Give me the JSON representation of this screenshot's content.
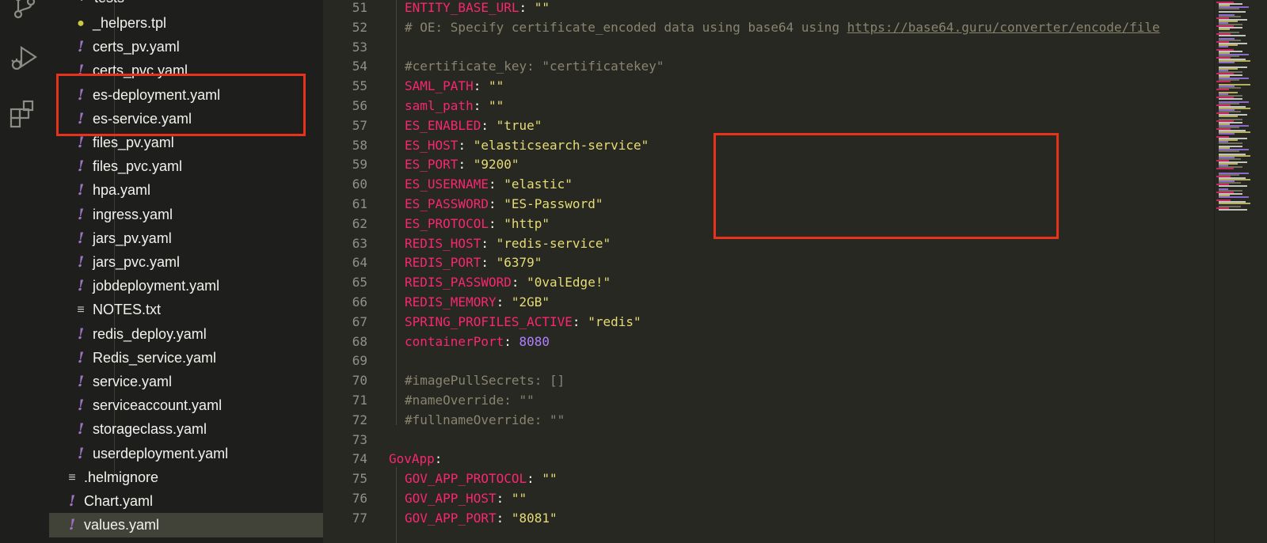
{
  "activity_bar": {
    "icons": [
      "source-control-icon",
      "run-debug-icon",
      "extensions-icon"
    ]
  },
  "sidebar": {
    "partial_top": "tests",
    "items": [
      {
        "label": "_helpers.tpl",
        "icon": "lightbulb-icon"
      },
      {
        "label": "certs_pv.yaml",
        "icon": "yaml-icon"
      },
      {
        "label": "certs_pvc.yaml",
        "icon": "yaml-icon"
      },
      {
        "label": "es-deployment.yaml",
        "icon": "yaml-icon"
      },
      {
        "label": "es-service.yaml",
        "icon": "yaml-icon"
      },
      {
        "label": "files_pv.yaml",
        "icon": "yaml-icon"
      },
      {
        "label": "files_pvc.yaml",
        "icon": "yaml-icon"
      },
      {
        "label": "hpa.yaml",
        "icon": "yaml-icon"
      },
      {
        "label": "ingress.yaml",
        "icon": "yaml-icon"
      },
      {
        "label": "jars_pv.yaml",
        "icon": "yaml-icon"
      },
      {
        "label": "jars_pvc.yaml",
        "icon": "yaml-icon"
      },
      {
        "label": "jobdeployment.yaml",
        "icon": "yaml-icon"
      },
      {
        "label": "NOTES.txt",
        "icon": "text-file-icon"
      },
      {
        "label": "redis_deploy.yaml",
        "icon": "yaml-icon"
      },
      {
        "label": "Redis_service.yaml",
        "icon": "yaml-icon"
      },
      {
        "label": "service.yaml",
        "icon": "yaml-icon"
      },
      {
        "label": "serviceaccount.yaml",
        "icon": "yaml-icon"
      },
      {
        "label": "storageclass.yaml",
        "icon": "yaml-icon"
      },
      {
        "label": "userdeployment.yaml",
        "icon": "yaml-icon"
      },
      {
        "label": ".helmignore",
        "icon": "text-file-icon"
      },
      {
        "label": "Chart.yaml",
        "icon": "yaml-icon"
      },
      {
        "label": "values.yaml",
        "icon": "yaml-icon",
        "active": true
      }
    ]
  },
  "editor": {
    "lines": [
      {
        "n": "51",
        "parts": [
          [
            "k",
            "ENTITY_BASE_URL"
          ],
          [
            "p",
            ": "
          ],
          [
            "s",
            "\"\""
          ]
        ]
      },
      {
        "n": "52",
        "parts": [
          [
            "c",
            "# OE: Specify certificate_encoded data using base64 using "
          ],
          [
            "cu",
            "https://base64.guru/converter/encode/file"
          ]
        ]
      },
      {
        "n": "53",
        "parts": []
      },
      {
        "n": "54",
        "parts": [
          [
            "c",
            "#certificate_key: \"certificatekey\""
          ]
        ]
      },
      {
        "n": "55",
        "parts": [
          [
            "k",
            "SAML_PATH"
          ],
          [
            "p",
            ": "
          ],
          [
            "s",
            "\"\""
          ]
        ]
      },
      {
        "n": "56",
        "parts": [
          [
            "k",
            "saml_path"
          ],
          [
            "p",
            ": "
          ],
          [
            "s",
            "\"\""
          ]
        ]
      },
      {
        "n": "57",
        "parts": [
          [
            "k",
            "ES_ENABLED"
          ],
          [
            "p",
            ": "
          ],
          [
            "s",
            "\"true\""
          ]
        ]
      },
      {
        "n": "58",
        "parts": [
          [
            "k",
            "ES_HOST"
          ],
          [
            "p",
            ": "
          ],
          [
            "s",
            "\"elasticsearch-service\""
          ]
        ]
      },
      {
        "n": "59",
        "parts": [
          [
            "k",
            "ES_PORT"
          ],
          [
            "p",
            ": "
          ],
          [
            "s",
            "\"9200\""
          ]
        ]
      },
      {
        "n": "60",
        "parts": [
          [
            "k",
            "ES_USERNAME"
          ],
          [
            "p",
            ": "
          ],
          [
            "s",
            "\"elastic\""
          ]
        ]
      },
      {
        "n": "61",
        "parts": [
          [
            "k",
            "ES_PASSWORD"
          ],
          [
            "p",
            ": "
          ],
          [
            "s",
            "\"ES-Password\""
          ]
        ]
      },
      {
        "n": "62",
        "parts": [
          [
            "k",
            "ES_PROTOCOL"
          ],
          [
            "p",
            ": "
          ],
          [
            "s",
            "\"http\""
          ]
        ]
      },
      {
        "n": "63",
        "parts": [
          [
            "k",
            "REDIS_HOST"
          ],
          [
            "p",
            ": "
          ],
          [
            "s",
            "\"redis-service\""
          ]
        ]
      },
      {
        "n": "64",
        "parts": [
          [
            "k",
            "REDIS_PORT"
          ],
          [
            "p",
            ": "
          ],
          [
            "s",
            "\"6379\""
          ]
        ]
      },
      {
        "n": "65",
        "parts": [
          [
            "k",
            "REDIS_PASSWORD"
          ],
          [
            "p",
            ": "
          ],
          [
            "s",
            "\"0valEdge!\""
          ]
        ]
      },
      {
        "n": "66",
        "parts": [
          [
            "k",
            "REDIS_MEMORY"
          ],
          [
            "p",
            ": "
          ],
          [
            "s",
            "\"2GB\""
          ]
        ]
      },
      {
        "n": "67",
        "parts": [
          [
            "k",
            "SPRING_PROFILES_ACTIVE"
          ],
          [
            "p",
            ": "
          ],
          [
            "s",
            "\"redis\""
          ]
        ]
      },
      {
        "n": "68",
        "parts": [
          [
            "k",
            "containerPort"
          ],
          [
            "p",
            ": "
          ],
          [
            "n",
            "8080"
          ]
        ]
      },
      {
        "n": "69",
        "parts": []
      },
      {
        "n": "70",
        "parts": [
          [
            "c",
            "#imagePullSecrets: []"
          ]
        ]
      },
      {
        "n": "71",
        "parts": [
          [
            "c",
            "#nameOverride: \"\""
          ]
        ]
      },
      {
        "n": "72",
        "parts": [
          [
            "c",
            "#fullnameOverride: \"\""
          ]
        ]
      },
      {
        "n": "73",
        "parts": []
      },
      {
        "n": "74",
        "indent0": true,
        "parts": [
          [
            "k",
            "GovApp"
          ],
          [
            "p",
            ":"
          ]
        ]
      },
      {
        "n": "75",
        "parts": [
          [
            "k",
            "GOV_APP_PROTOCOL"
          ],
          [
            "p",
            ": "
          ],
          [
            "s",
            "\"\""
          ]
        ]
      },
      {
        "n": "76",
        "parts": [
          [
            "k",
            "GOV_APP_HOST"
          ],
          [
            "p",
            ": "
          ],
          [
            "s",
            "\"\""
          ]
        ]
      },
      {
        "n": "77",
        "parts": [
          [
            "k",
            "GOV_APP_PORT"
          ],
          [
            "p",
            ": "
          ],
          [
            "s",
            "\"8081\""
          ]
        ]
      }
    ]
  },
  "colors": {
    "highlight": "#e8321c",
    "keyword": "#f92672",
    "string": "#e6db74",
    "number": "#ae81ff",
    "comment": "#88846f",
    "yaml_icon": "#a074c4"
  }
}
